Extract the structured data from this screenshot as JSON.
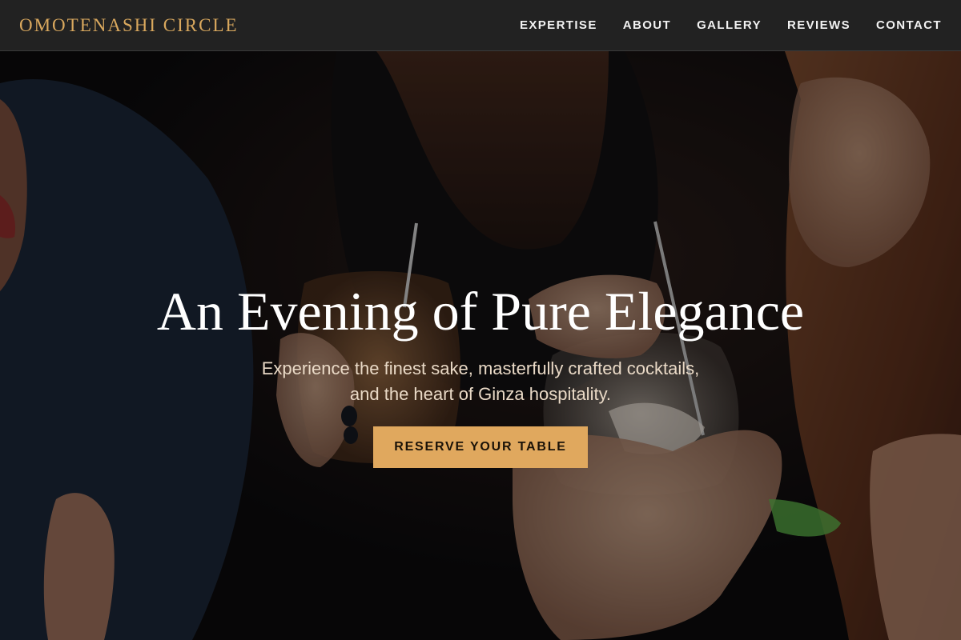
{
  "brand": {
    "name": "OMOTENASHI CIRCLE"
  },
  "nav": {
    "links": [
      {
        "label": "EXPERTISE"
      },
      {
        "label": "ABOUT"
      },
      {
        "label": "GALLERY"
      },
      {
        "label": "REVIEWS"
      },
      {
        "label": "CONTACT"
      }
    ]
  },
  "hero": {
    "title": "An Evening of Pure Elegance",
    "subtitle_line1": "Experience the finest sake, masterfully crafted cocktails,",
    "subtitle_line2": "and the heart of Ginza hospitality.",
    "cta_label": "RESERVE YOUR TABLE"
  },
  "colors": {
    "navbar_bg": "#222222",
    "brand_gold": "#d9a85e",
    "cta_bg": "#e0a85e",
    "hero_text": "#ffffff"
  }
}
